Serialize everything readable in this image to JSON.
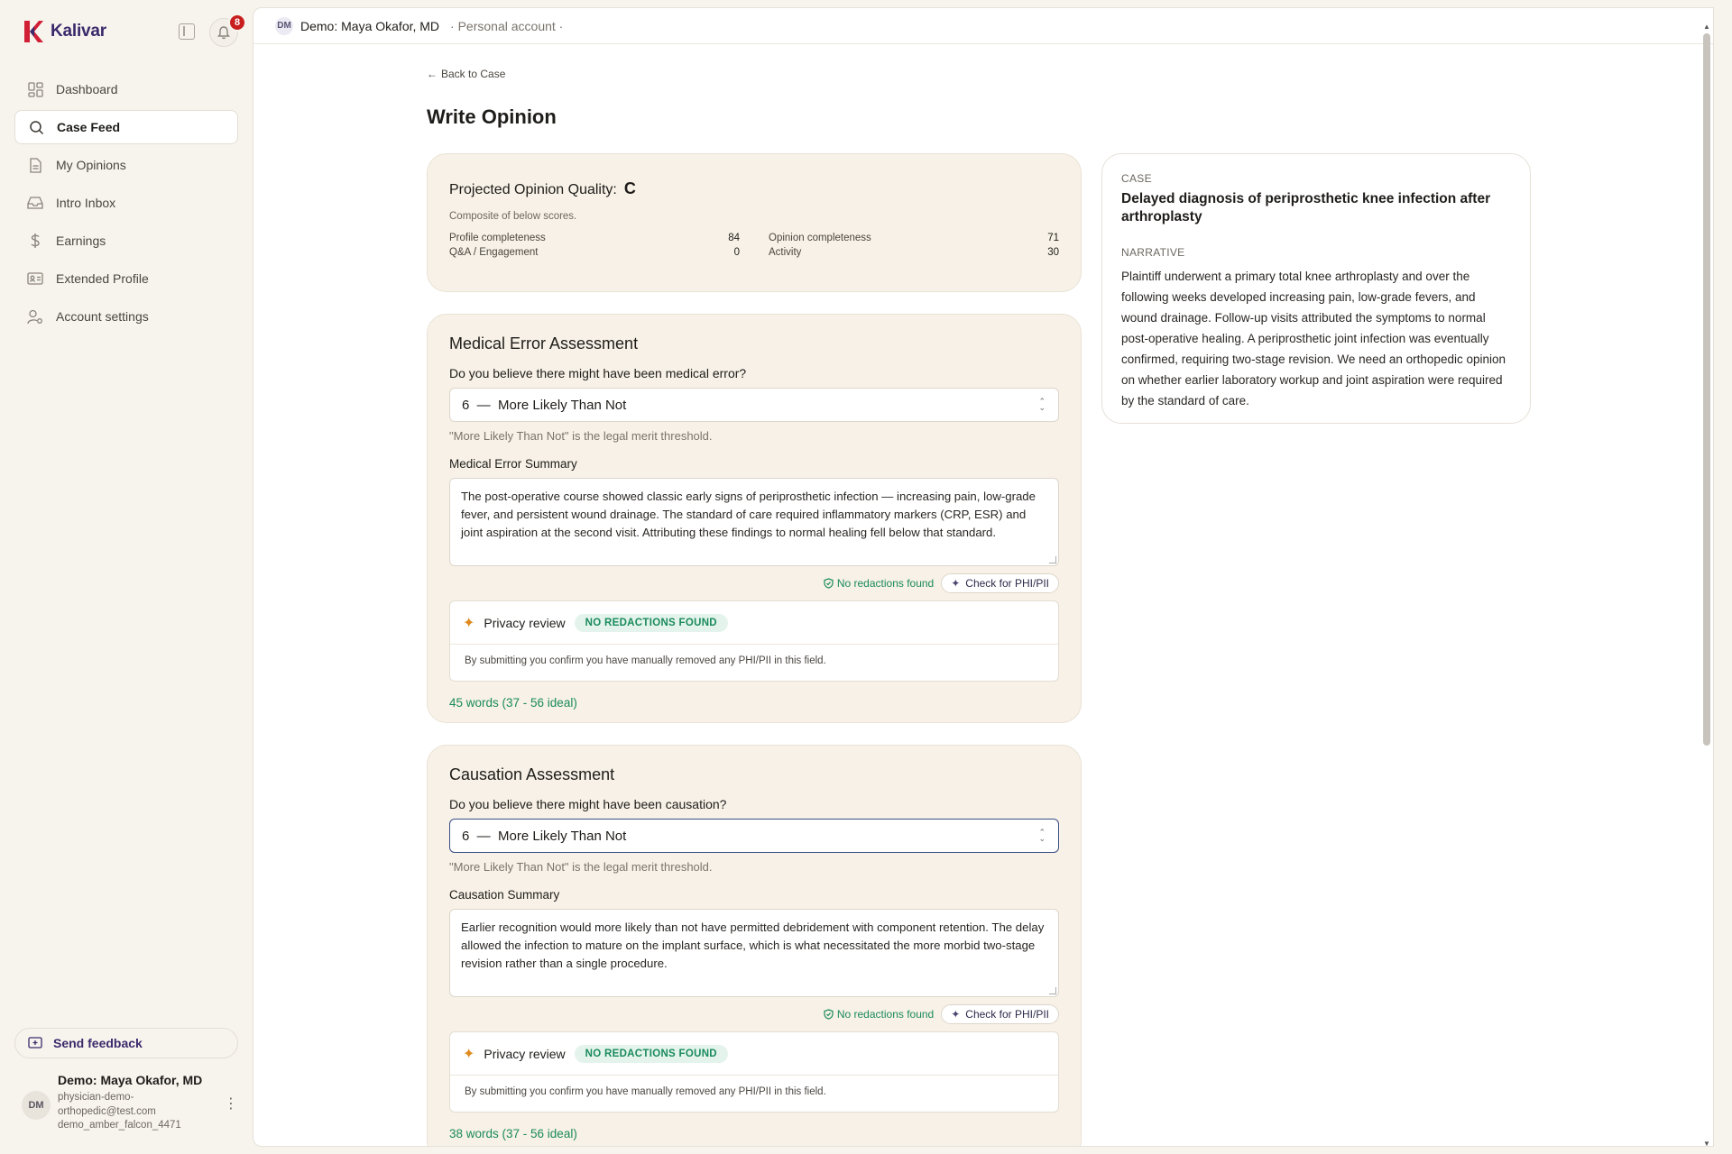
{
  "app": {
    "name": "Kalivar",
    "notification_count": "8"
  },
  "nav": [
    {
      "label": "Dashboard",
      "icon": "dashboard-icon"
    },
    {
      "label": "Case Feed",
      "icon": "search-icon",
      "active": true
    },
    {
      "label": "My Opinions",
      "icon": "document-icon"
    },
    {
      "label": "Intro Inbox",
      "icon": "inbox-icon"
    },
    {
      "label": "Earnings",
      "icon": "dollar-icon"
    },
    {
      "label": "Extended Profile",
      "icon": "id-card-icon"
    },
    {
      "label": "Account settings",
      "icon": "user-gear-icon"
    }
  ],
  "feedback": {
    "label": "Send feedback"
  },
  "user": {
    "initials": "DM",
    "name": "Demo: Maya Okafor, MD",
    "email": "physician-demo-orthopedic@test.com",
    "handle": "demo_amber_falcon_4471"
  },
  "topbar": {
    "initials": "DM",
    "name": "Demo: Maya Okafor, MD",
    "account": "· Personal account ·"
  },
  "page": {
    "back_label": "Back to Case",
    "title": "Write Opinion"
  },
  "quality": {
    "title": "Projected Opinion Quality:",
    "grade": "C",
    "note": "Composite of below scores.",
    "scores": [
      {
        "label": "Profile completeness",
        "value": "84"
      },
      {
        "label": "Opinion completeness",
        "value": "71"
      },
      {
        "label": "Q&A / Engagement",
        "value": "0"
      },
      {
        "label": "Activity",
        "value": "30"
      }
    ]
  },
  "medical": {
    "title": "Medical Error Assessment",
    "question": "Do you believe there might have been medical error?",
    "selected": "6  —  More Likely Than Not",
    "hint": "\"More Likely Than Not\" is the legal merit threshold.",
    "summary_label": "Medical Error Summary",
    "summary": "The post-operative course showed classic early signs of periprosthetic infection — increasing pain, low-grade fever, and persistent wound drainage. The standard of care required inflammatory markers (CRP, ESR) and joint aspiration at the second visit. Attributing these findings to normal healing fell below that standard.",
    "no_redactions": "No redactions found",
    "phi_button": "Check for PHI/PII",
    "privacy_label": "Privacy review",
    "privacy_badge": "NO REDACTIONS FOUND",
    "privacy_note": "By submitting you confirm you have manually removed any PHI/PII in this field.",
    "word_count": "45 words (37 - 56 ideal)"
  },
  "causation": {
    "title": "Causation Assessment",
    "question": "Do you believe there might have been causation?",
    "selected": "6  —  More Likely Than Not",
    "hint": "\"More Likely Than Not\" is the legal merit threshold.",
    "summary_label": "Causation Summary",
    "summary": "Earlier recognition would more likely than not have permitted debridement with component retention. The delay allowed the infection to mature on the implant surface, which is what necessitated the more morbid two-stage revision rather than a single procedure.",
    "no_redactions": "No redactions found",
    "phi_button": "Check for PHI/PII",
    "privacy_label": "Privacy review",
    "privacy_badge": "NO REDACTIONS FOUND",
    "privacy_note": "By submitting you confirm you have manually removed any PHI/PII in this field.",
    "word_count": "38 words (37 - 56 ideal)"
  },
  "case": {
    "kicker": "CASE",
    "title": "Delayed diagnosis of periprosthetic knee infection after arthroplasty",
    "narrative_kicker": "NARRATIVE",
    "narrative": "Plaintiff underwent a primary total knee arthroplasty and over the following weeks developed increasing pain, low-grade fevers, and wound drainage. Follow-up visits attributed the symptoms to normal post-operative healing. A periprosthetic joint infection was eventually confirmed, requiring two-stage revision. We need an orthopedic opinion on whether earlier laboratory workup and joint aspiration were required by the standard of care."
  },
  "colors": {
    "brand": "#3a2a6b",
    "logo_red": "#d11f35",
    "success": "#1a8a5c",
    "badge": "#c81e1e"
  }
}
